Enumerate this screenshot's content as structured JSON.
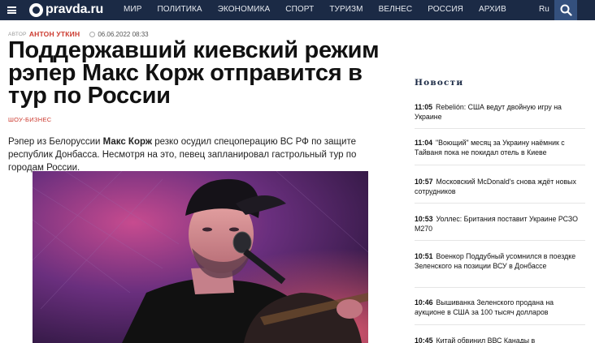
{
  "header": {
    "logo_text": "pravda.ru",
    "nav": [
      "МИР",
      "ПОЛИТИКА",
      "ЭКОНОМИКА",
      "СПОРТ",
      "ТУРИЗМ",
      "ВЕЛНЕС",
      "РОССИЯ",
      "АРХИВ"
    ],
    "lang": "Ru",
    "icons": {
      "menu": "hamburger-icon",
      "search": "search-icon"
    }
  },
  "article": {
    "author_prefix": "АВТОР",
    "author": "АНТОН УТКИН",
    "date": "06.06.2022 08:33",
    "title": "Поддержавший киевский режим рэпер Макс Корж отправится в тур по России",
    "category": "ШОУ-БИЗНЕС",
    "lead_part1": "Рэпер из Белоруссии ",
    "lead_bold": "Макс Корж",
    "lead_part2": " резко осудил спецоперацию ВС РФ по защите республик Донбасса. Несмотря на это, певец запланировал гастрольный тур по городам России."
  },
  "sidebar": {
    "title": "Новости",
    "items": [
      {
        "time": "11:05",
        "text": "Rebelión: США ведут двойную игру на Украине"
      },
      {
        "time": "11:04",
        "text": "\"Воющий\" месяц за Украину наёмник с Тайваня пока не покидал отель в Киеве"
      },
      {
        "time": "10:57",
        "text": "Московский McDonald's снова ждёт новых сотрудников"
      },
      {
        "time": "10:53",
        "text": "Уоллес: Британия поставит Украине РСЗО M270"
      },
      {
        "time": "10:51",
        "text": "Военкор Поддубный усомнился в поездке Зеленского на позиции ВСУ в Донбассе"
      },
      {
        "time": "10:46",
        "text": "Вышиванка Зеленского продана на аукционе в США за 100 тысяч долларов"
      },
      {
        "time": "10:45",
        "text": "Китай обвинил ВВС Канады в"
      }
    ]
  },
  "colors": {
    "topbar": "#1b2a45",
    "search_button": "#34507d",
    "accent_red": "#cc3a2f"
  }
}
